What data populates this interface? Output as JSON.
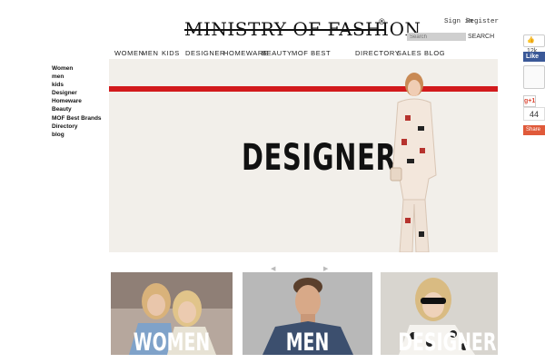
{
  "header": {
    "logo_text": "MINISTRY OF FASHION",
    "logo_reg": "®",
    "sign_in": "Sign in",
    "register": "Register",
    "search_placeholder": "Search",
    "search_button": "SEARCH"
  },
  "nav": {
    "women": "WOMEN",
    "men": "MEN",
    "kids": "KIDS",
    "designer": "DESIGNER",
    "homeware": "HOMEWARE",
    "beauty": "BEAUTY",
    "mof_best_brands": "MOF BEST BRANDS",
    "directory": "DIRECTORY",
    "sales": "SALES",
    "blog": "BLOG"
  },
  "sidebar": {
    "items": [
      "Women",
      "men",
      "kids",
      "Designer",
      "Homeware",
      "Beauty",
      "MOF Best Brands",
      "Directory",
      "blog"
    ]
  },
  "hero": {
    "title": "DESIGNER",
    "stripe_color": "#d21a1c"
  },
  "carousel": {
    "prev_icon": "◀",
    "next_icon": "▶"
  },
  "tiles": {
    "women": "WOMEN",
    "men": "MEN",
    "designer": "DESIGNER"
  },
  "social": {
    "fb_count": "12k",
    "fb_like": "Like",
    "gplus": "g+1",
    "gplus_count": "44",
    "share": "Share"
  },
  "colors": {
    "accent_red": "#d21a1c",
    "facebook_blue": "#3b5998"
  }
}
